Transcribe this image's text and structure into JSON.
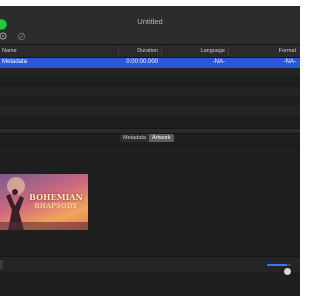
{
  "window": {
    "title": "Untitled"
  },
  "toolbar": [
    {
      "name": "action-menu-button",
      "icon": "gear-icon"
    },
    {
      "name": "remove-button",
      "icon": "circle-slash-icon"
    }
  ],
  "table": {
    "columns": [
      "Name",
      "Duration",
      "Language",
      "Format"
    ],
    "rows": [
      {
        "name": "Metadata",
        "duration": "0:00:00.000",
        "language": "-NA-",
        "format": "-NA-"
      }
    ]
  },
  "tabs": {
    "items": [
      "Metadata",
      "Artwork"
    ],
    "selected": "Artwork"
  },
  "artwork": {
    "title_line1": "BOHEMIAN",
    "title_line2": "RHAPSODY"
  },
  "zoom": {
    "value": 0.85
  },
  "colors": {
    "selection": "#2859d9",
    "accent": "#2f7bf6",
    "traffic_green": "#27c93f"
  }
}
